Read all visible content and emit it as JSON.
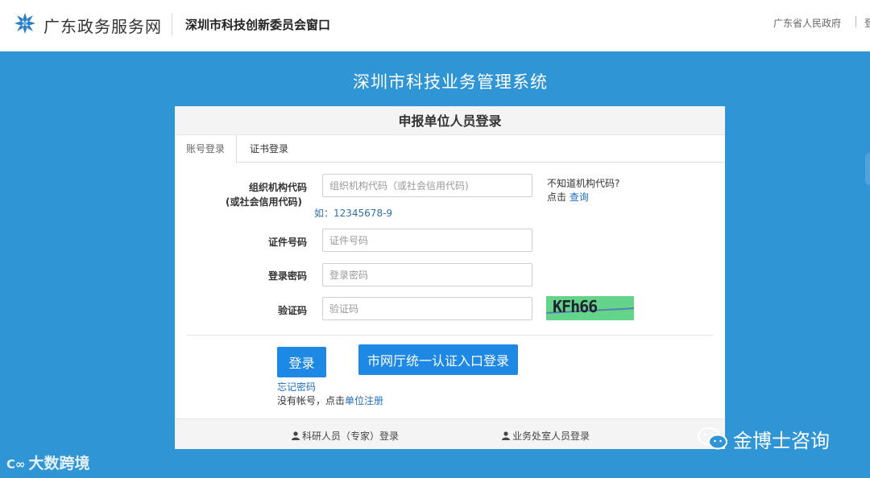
{
  "header": {
    "site_name": "广东政务服务网",
    "window_name": "深圳市科技创新委员会窗口",
    "gov_link": "广东省人民政府",
    "more_link": "登"
  },
  "system_title": "深圳市科技业务管理系统",
  "login_panel": {
    "title": "申报单位人员登录",
    "tabs": [
      {
        "label": "账号登录",
        "active": true
      },
      {
        "label": "证书登录",
        "active": false
      }
    ],
    "org_code": {
      "label": "组织机构代码",
      "label_sub": "(或社会信用代码)",
      "placeholder": "组织机构代码（或社会信用代码)",
      "example": "如：12345678-9",
      "hint_line1": "不知道机构代码?",
      "hint_prefix": "点击",
      "hint_link": "查询"
    },
    "cert_no": {
      "label": "证件号码",
      "placeholder": "证件号码"
    },
    "password": {
      "label": "登录密码",
      "placeholder": "登录密码"
    },
    "captcha": {
      "label": "验证码",
      "placeholder": "验证码",
      "image_text": "KFh66"
    },
    "login_button": "登录",
    "unified_button": "市网厅统一认证入口登录",
    "forgot_password": "忘记密码",
    "register_prefix": "没有帐号，点击",
    "register_link": "单位注册",
    "footer_links": [
      "科研人员（专家）登录",
      "业务处室人员登录"
    ]
  },
  "watermarks": {
    "left_mark": "C∞",
    "left_text": "大数跨境",
    "right_text": "金博士咨询"
  },
  "colors": {
    "background": "#2f95d4",
    "primary_button": "#1e88e5",
    "link": "#1f6fc0",
    "captcha_bg": "#63d48a"
  }
}
